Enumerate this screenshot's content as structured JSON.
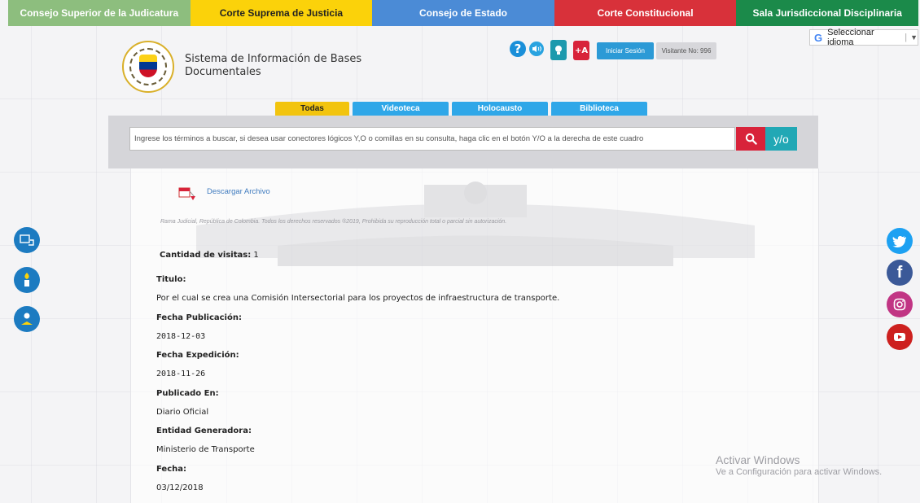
{
  "top_nav": [
    {
      "label": "Consejo Superior de la Judicatura",
      "bg": "#8dbe7e",
      "color": "#ffffff"
    },
    {
      "label": "Corte Suprema de Justicia",
      "bg": "#fbd20a",
      "color": "#222222"
    },
    {
      "label": "Consejo de Estado",
      "bg": "#4b8bd6",
      "color": "#ffffff"
    },
    {
      "label": "Corte Constitucional",
      "bg": "#d8313a",
      "color": "#ffffff"
    },
    {
      "label": "Sala Jurisdiccional Disciplinaria",
      "bg": "#1b8a4a",
      "color": "#ffffff"
    }
  ],
  "translate": {
    "label": "Seleccionar idioma",
    "icon": "google-g-icon"
  },
  "header": {
    "title": "Sistema de Información de Bases Documentales",
    "login_label": "Iniciar Sesión",
    "visitors_label": "Visitante No: 996",
    "plus_a_label": "+A",
    "help_label": "?"
  },
  "tabs": [
    {
      "label": "Todas",
      "bg": "#f2c40e",
      "color": "#222222"
    },
    {
      "label": "Videoteca",
      "bg": "#2fa7e8",
      "color": "#ffffff"
    },
    {
      "label": "Holocausto",
      "bg": "#2fa7e8",
      "color": "#ffffff"
    },
    {
      "label": "Biblioteca",
      "bg": "#2fa7e8",
      "color": "#ffffff"
    }
  ],
  "search": {
    "placeholder": "Ingrese los términos a buscar, si desea usar conectores lógicos Y,O o comillas en su consulta, haga clic en el botón Y/O a la derecha de este cuadro",
    "yo_label": "y/o"
  },
  "document": {
    "download_label": "Descargar Archivo",
    "copyright": "Rama Judicial, República de Colombia. Todos los derechos reservados ®2019, Prohibida su reproducción total o parcial sin autorización.",
    "visits_label": "Cantidad de visitas:",
    "visits_value": "1",
    "fields": [
      {
        "label": "Titulo:",
        "value": "Por el cual se crea una Comisión Intersectorial para los proyectos de infraestructura de transporte."
      },
      {
        "label": "Fecha Publicación:",
        "value": "2018-12-03"
      },
      {
        "label": "Fecha Expedición:",
        "value": "2018-11-26"
      },
      {
        "label": "Publicado En:",
        "value": "Diario Oficial"
      },
      {
        "label": "Entidad Generadora:",
        "value": "Ministerio de Transporte"
      },
      {
        "label": "Fecha:",
        "value": "03/12/2018"
      }
    ]
  },
  "left_icons": [
    "media-library-icon",
    "torch-icon",
    "reader-icon"
  ],
  "social": [
    {
      "name": "twitter-icon",
      "bg": "#1da1f2"
    },
    {
      "name": "facebook-icon",
      "bg": "#3b5998"
    },
    {
      "name": "instagram-icon",
      "bg": "#c13584"
    },
    {
      "name": "youtube-icon",
      "bg": "#cd201f"
    }
  ],
  "watermark": {
    "line1": "Activar Windows",
    "line2": "Ve a Configuración para activar Windows."
  }
}
